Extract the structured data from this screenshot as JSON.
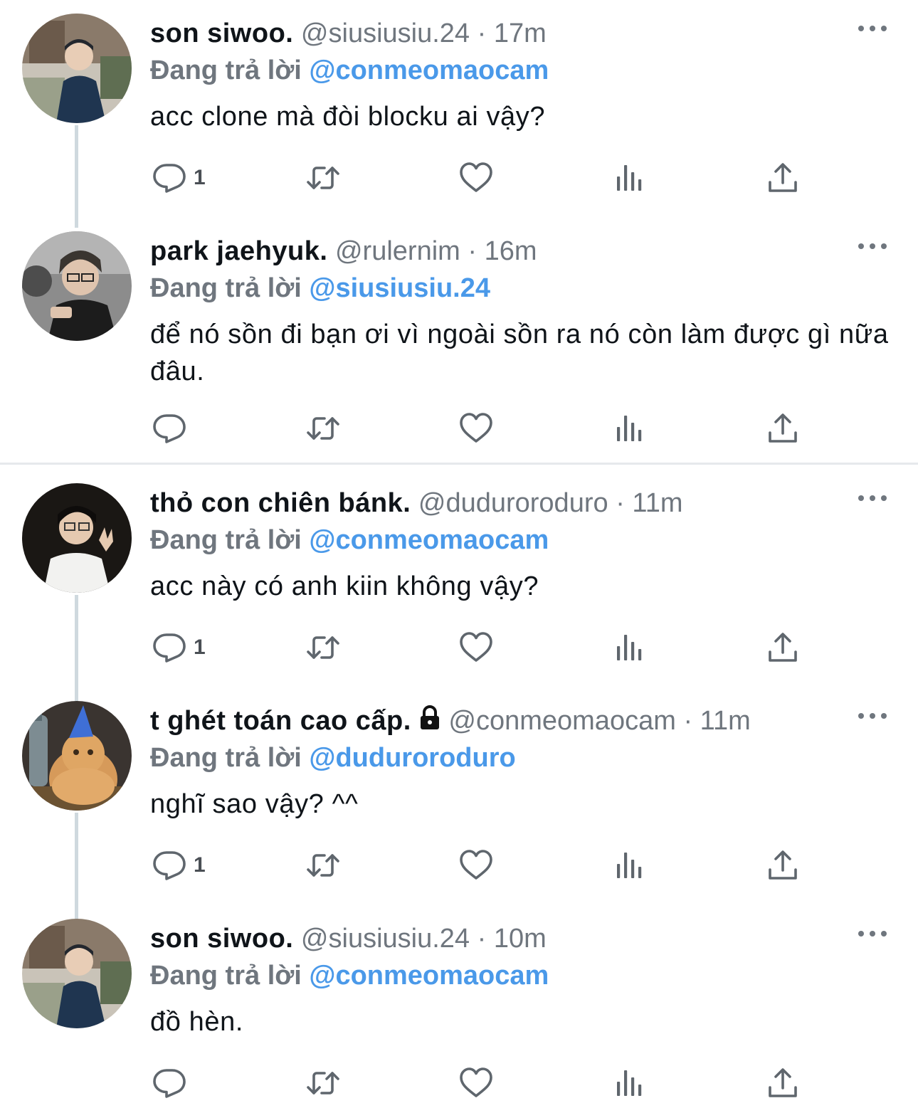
{
  "tweets": [
    {
      "name": "son siwoo.",
      "handle": "@siusiusiu.24",
      "dot": "·",
      "time": "17m",
      "reply_prefix": "Đang trả lời",
      "reply_target": "@conmeomaocam",
      "text": "acc clone mà đòi blocku ai vậy?",
      "reply_count": "1",
      "locked": false
    },
    {
      "name": "park jaehyuk.",
      "handle": "@rulernim",
      "dot": "·",
      "time": "16m",
      "reply_prefix": "Đang trả lời",
      "reply_target": "@siusiusiu.24",
      "text": "để nó sồn đi bạn ơi vì ngoài sồn ra nó còn làm được gì nữa đâu.",
      "reply_count": "",
      "locked": false
    },
    {
      "name": "thỏ con chiên bánk.",
      "handle": "@duduroroduro",
      "dot": "·",
      "time": "11m",
      "reply_prefix": "Đang trả lời",
      "reply_target": "@conmeomaocam",
      "text": "acc này có anh kiin không vậy?",
      "reply_count": "1",
      "locked": false
    },
    {
      "name": "t ghét toán cao cấp.",
      "handle": "@conmeomaocam",
      "dot": "·",
      "time": "11m",
      "reply_prefix": "Đang trả lời",
      "reply_target": "@duduroroduro",
      "text": "nghĩ sao vậy? ^^",
      "reply_count": "1",
      "locked": true
    },
    {
      "name": "son siwoo.",
      "handle": "@siusiusiu.24",
      "dot": "·",
      "time": "10m",
      "reply_prefix": "Đang trả lời",
      "reply_target": "@conmeomaocam",
      "text": "đồ hèn.",
      "reply_count": "",
      "locked": false
    }
  ],
  "icons": {
    "reply": "reply-icon",
    "retweet": "retweet-icon",
    "like": "like-icon",
    "views": "views-icon",
    "share": "share-icon",
    "more": "more-icon",
    "lock": "lock-icon"
  },
  "colors": {
    "link": "#4a99e9",
    "secondary": "#6f767e",
    "thread_line": "#cfd9de"
  }
}
